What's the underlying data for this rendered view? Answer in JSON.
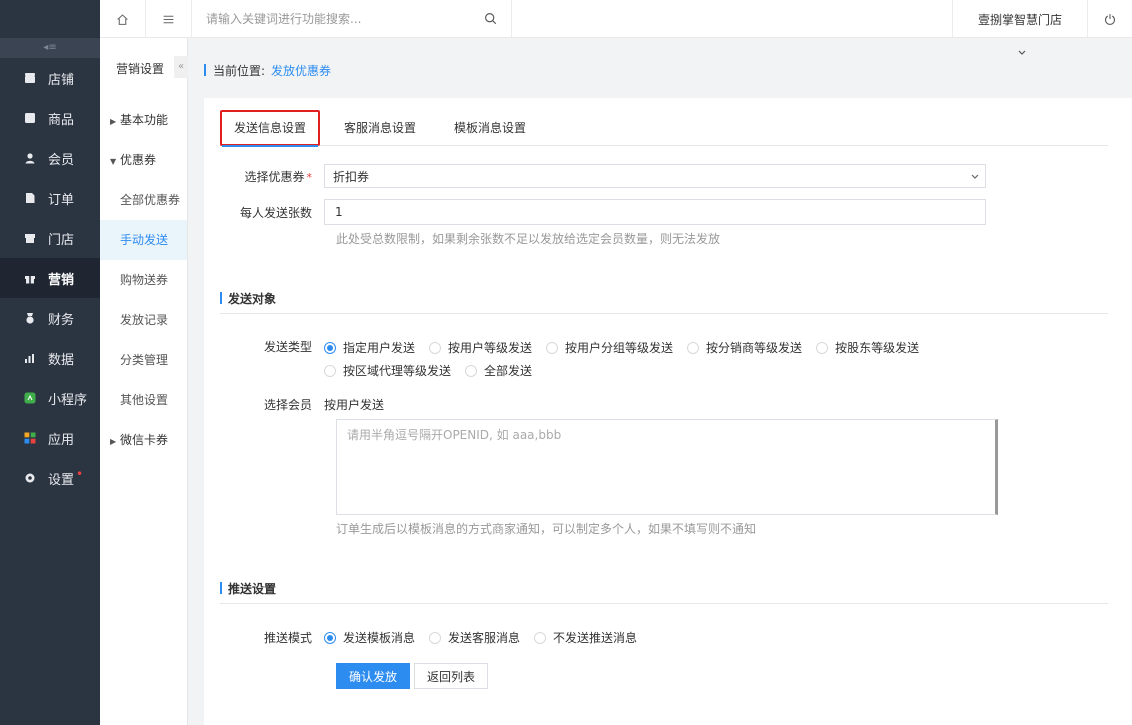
{
  "nav": {
    "collapse_glyph": "◂≡",
    "items": [
      {
        "label": "店铺",
        "icon": "store-icon"
      },
      {
        "label": "商品",
        "icon": "goods-icon"
      },
      {
        "label": "会员",
        "icon": "member-icon"
      },
      {
        "label": "订单",
        "icon": "order-icon"
      },
      {
        "label": "门店",
        "icon": "shop-icon"
      },
      {
        "label": "营销",
        "icon": "gift-icon"
      },
      {
        "label": "财务",
        "icon": "finance-icon"
      },
      {
        "label": "数据",
        "icon": "data-icon"
      },
      {
        "label": "小程序",
        "icon": "miniprogram-icon"
      },
      {
        "label": "应用",
        "icon": "apps-icon"
      },
      {
        "label": "设置",
        "icon": "gear-icon"
      }
    ],
    "active": "营销"
  },
  "header": {
    "search_placeholder": "请输入关键词进行功能搜索...",
    "store_name": "壹捌掌智慧门店"
  },
  "subnav": {
    "title": "营销设置",
    "fold_glyph": "«",
    "items": [
      {
        "label": "基本功能",
        "type": "group",
        "arrow": "▶"
      },
      {
        "label": "优惠券",
        "type": "group",
        "arrow": "▼"
      },
      {
        "label": "全部优惠券"
      },
      {
        "label": "手动发送"
      },
      {
        "label": "购物送券"
      },
      {
        "label": "发放记录"
      },
      {
        "label": "分类管理"
      },
      {
        "label": "其他设置"
      },
      {
        "label": "微信卡券",
        "type": "group",
        "arrow": "▶"
      }
    ],
    "active": "手动发送"
  },
  "breadcrumb": {
    "label": "当前位置:",
    "current": "发放优惠券"
  },
  "tabs": [
    "发送信息设置",
    "客服消息设置",
    "模板消息设置"
  ],
  "form": {
    "coupon_label": "选择优惠券",
    "coupon_required": "*",
    "coupon_value": "折扣券",
    "count_label": "每人发送张数",
    "count_value": "1",
    "count_hint": "此处受总数限制，如果剩余张数不足以发放给选定会员数量，则无法发放",
    "section_target": "发送对象",
    "send_type_label": "发送类型",
    "send_types": [
      "指定用户发送",
      "按用户等级发送",
      "按用户分组等级发送",
      "按分销商等级发送",
      "按股东等级发送",
      "按区域代理等级发送",
      "全部发送"
    ],
    "send_type_selected": "指定用户发送",
    "member_label": "选择会员",
    "member_mode": "按用户发送",
    "openid_placeholder": "请用半角逗号隔开OPENID, 如 aaa,bbb",
    "openid_hint": "订单生成后以模板消息的方式商家通知，可以制定多个人，如果不填写则不通知",
    "section_push": "推送设置",
    "push_label": "推送模式",
    "push_modes": [
      "发送模板消息",
      "发送客服消息",
      "不发送推送消息"
    ],
    "push_selected": "发送模板消息",
    "submit_label": "确认发放",
    "back_label": "返回列表"
  },
  "colors": {
    "accent": "#2d8cf0",
    "nav_bg": "#2b3441",
    "highlight_border": "#e02020"
  }
}
